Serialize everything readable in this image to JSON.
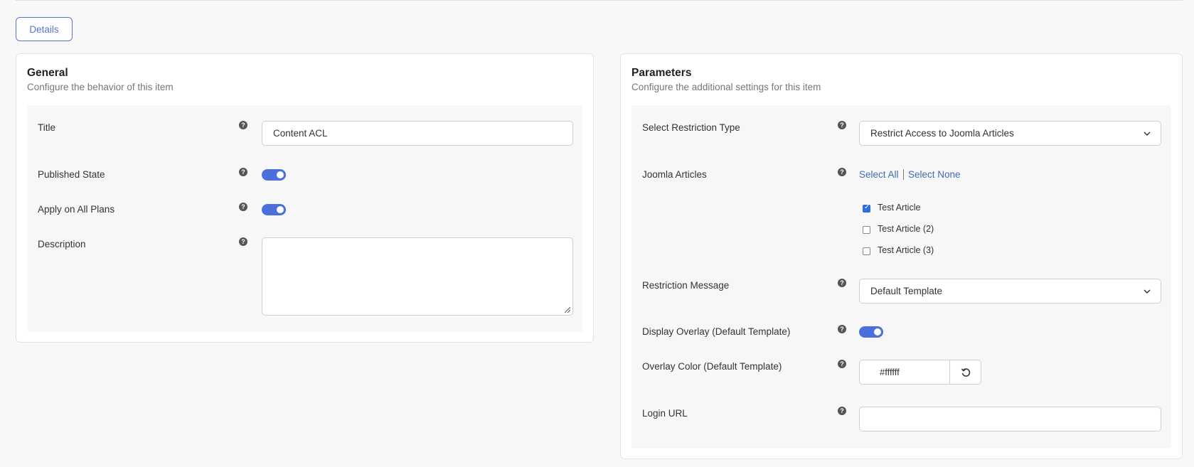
{
  "tabs": {
    "details_label": "Details"
  },
  "general": {
    "title": "General",
    "subtitle": "Configure the behavior of this item",
    "fields": {
      "title_label": "Title",
      "title_value": "Content ACL",
      "published_label": "Published State",
      "apply_label": "Apply on All Plans",
      "description_label": "Description",
      "description_value": ""
    }
  },
  "parameters": {
    "title": "Parameters",
    "subtitle": "Configure the additional settings for this item",
    "fields": {
      "restriction_type_label": "Select Restriction Type",
      "restriction_type_value": "Restrict Access to Joomla Articles",
      "articles_label": "Joomla Articles",
      "select_all": "Select All",
      "select_none": "Select None",
      "articles": [
        {
          "label": "Test Article",
          "checked": true
        },
        {
          "label": "Test Article (2)",
          "checked": false
        },
        {
          "label": "Test Article (3)",
          "checked": false
        }
      ],
      "restriction_message_label": "Restriction Message",
      "restriction_message_value": "Default Template",
      "overlay_label": "Display Overlay (Default Template)",
      "overlay_color_label": "Overlay Color (Default Template)",
      "overlay_color_value": "#ffffff",
      "login_url_label": "Login URL",
      "login_url_value": ""
    }
  },
  "icons": {
    "help": "?"
  },
  "colors": {
    "accent": "#4b6fdb",
    "link": "#3f6bb6"
  }
}
